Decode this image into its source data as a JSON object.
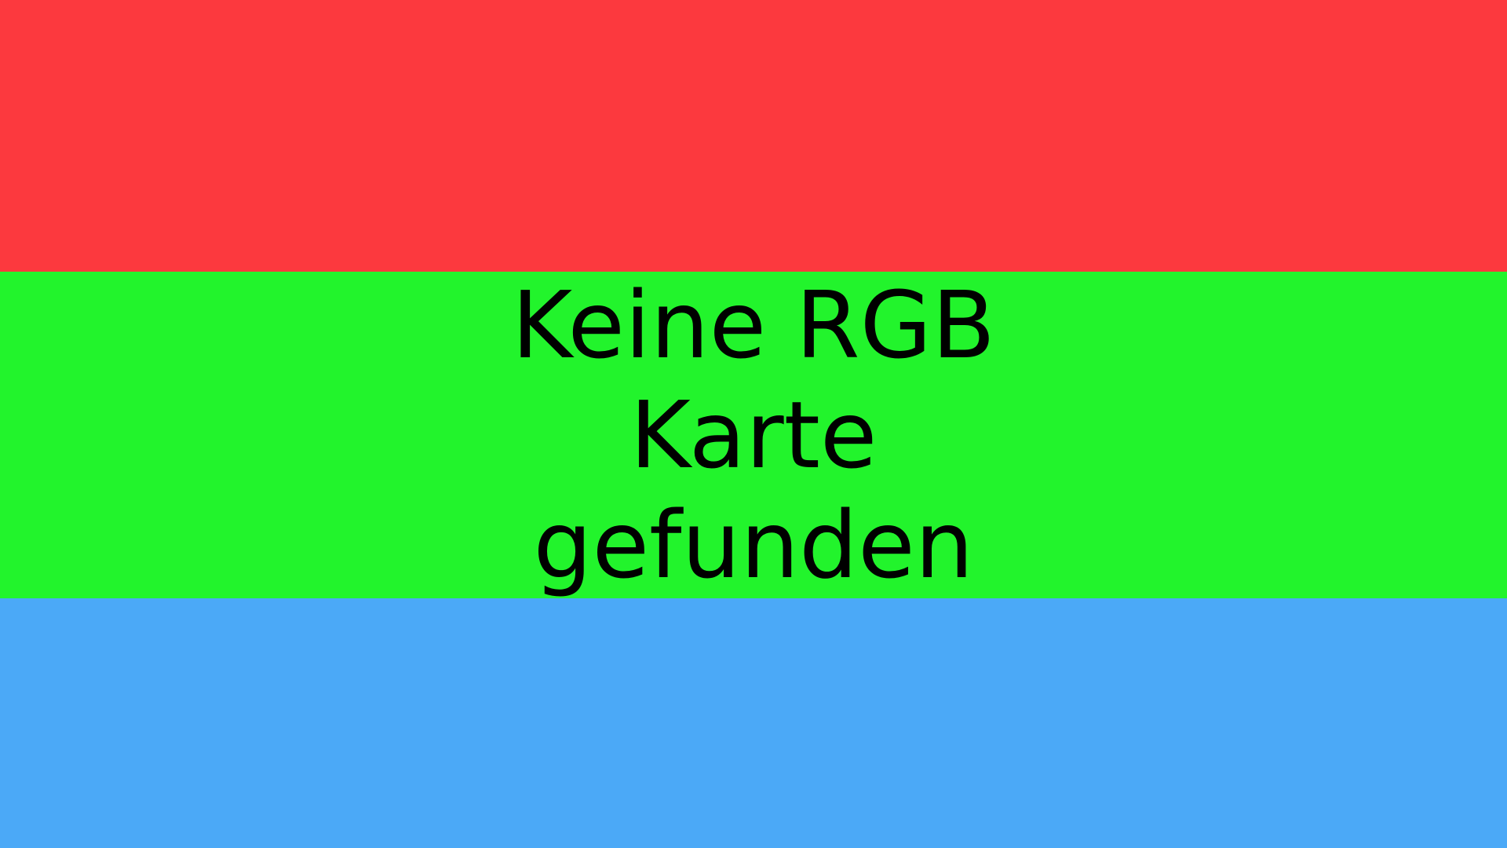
{
  "bands": {
    "top_color": "#fc393e",
    "middle_color": "#22f42c",
    "bottom_color": "#4ba9f7"
  },
  "message": {
    "lines": [
      "Keine RGB",
      "Karte",
      "gefunden"
    ],
    "text_color": "#000000"
  }
}
